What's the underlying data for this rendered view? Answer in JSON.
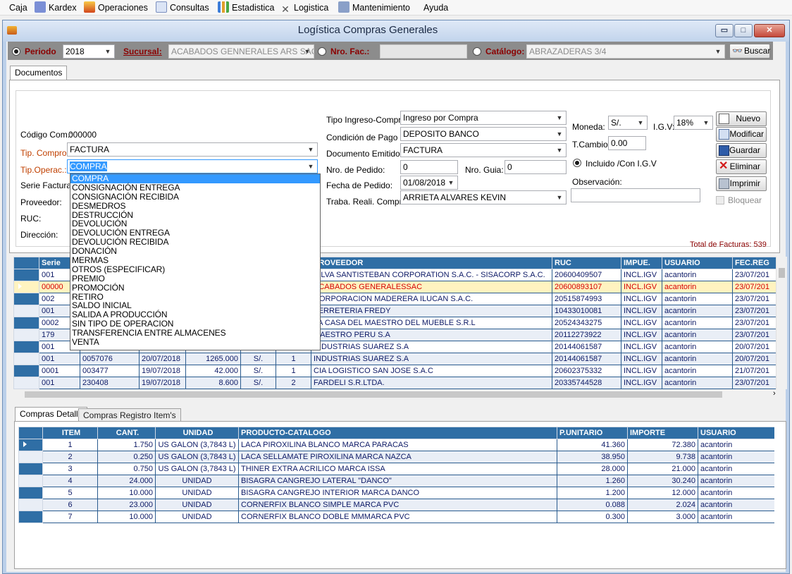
{
  "menu": [
    {
      "label": "Caja",
      "icon": "none"
    },
    {
      "label": "Kardex",
      "icon": "kardex-icon"
    },
    {
      "label": "Operaciones",
      "icon": "fire-icon"
    },
    {
      "label": "Consultas",
      "icon": "edit-icon"
    },
    {
      "label": "Estadistica",
      "icon": "chart-icon"
    },
    {
      "label": "Logistica",
      "icon": "tools-icon"
    },
    {
      "label": "Mantenimiento",
      "icon": "maintenance-icon"
    },
    {
      "label": "Ayuda",
      "icon": "none"
    }
  ],
  "window": {
    "title": "Logística Compras Generales",
    "min": "▭",
    "max": "□",
    "close": "✕"
  },
  "filter": {
    "periodo_label": "Periodo",
    "periodo_value": "2018",
    "sucursal_label": "Sucursal:",
    "sucursal_value": "ACABADOS GENNERALES ARS SAC",
    "nrofac_label": "Nro. Fac.:",
    "nrofac_value": "",
    "catalogo_label": "Catálogo:",
    "catalogo_value": "ABRAZADERAS 3/4",
    "buscar_label": "Buscar"
  },
  "tabs_top": {
    "documentos": "Documentos"
  },
  "form": {
    "codigo_label": "Código Com.:",
    "codigo_value": "000000",
    "tipcompro_label": "Tip. Compro.:",
    "tipcompro_value": "FACTURA",
    "tipoperac_label": "Tip.Operac.:",
    "tipoperac_value": "COMPRA",
    "serie_label": "Serie Factura:",
    "proveedor_label": "Proveedor:",
    "ruc_label": "RUC:",
    "direccion_label": "Dirección:",
    "tipo_ingreso_label": "Tipo Ingreso-Compra:",
    "tipo_ingreso_value": "Ingreso por Compra",
    "condicion_label": "Condición de Pago",
    "condicion_value": "DEPOSITO BANCO",
    "documento_label": "Documento Emitido:",
    "documento_value": "FACTURA",
    "nropedido_label": "Nro. de Pedido:",
    "nropedido_value": "0",
    "nroguia_label": "Nro. Guia:",
    "nroguia_value": "0",
    "fecha_label": "Fecha de Pedido:",
    "fecha_value": "01/08/2018",
    "trabajador_label": "Traba. Reali. Compra",
    "trabajador_value": "ARRIETA ALVARES KEVIN",
    "moneda_label": "Moneda:",
    "moneda_value": "S/.",
    "igv_label": "I.G.V:",
    "igv_value": "18%",
    "tcambio_label": "T.Cambio:",
    "tcambio_value": "0.00",
    "incluido_label": "Incluido /Con I.G.V",
    "observacion_label": "Observación:",
    "bloquear_label": "Bloquear",
    "total_label": "Total de Facturas:",
    "total_value": "539"
  },
  "actions": {
    "nuevo": "Nuevo",
    "modificar": "Modificar",
    "guardar": "Guardar",
    "eliminar": "Eliminar",
    "imprimir": "Imprimir"
  },
  "dropdown_items": [
    "COMPRA",
    "CONSIGNACIÓN ENTREGA",
    "CONSIGNACIÓN RECIBIDA",
    "DESMEDROS",
    "DESTRUCCIÓN",
    "DEVOLUCIÓN",
    "DEVOLUCIÓN ENTREGA",
    "DEVOLUCIÓN RECIBIDA",
    "DONACIÓN",
    "MERMAS",
    "OTROS (ESPECIFICAR)",
    "PREMIO",
    "PROMOCIÓN",
    "RETIRO",
    "SALDO INICIAL",
    "SALIDA A PRODUCCIÓN",
    "SIN TIPO DE OPERACION",
    "TRANSFERENCIA ENTRE ALMACENES",
    "VENTA"
  ],
  "grid1": {
    "headers": [
      "Serie",
      "",
      "",
      "",
      "",
      "",
      "PROVEEDOR",
      "RUC",
      "IMPUE.",
      "USUARIO",
      "FEC.REG"
    ],
    "rows": [
      {
        "serie": "001",
        "num": "",
        "fecha": "",
        "total": "",
        "mon": "",
        "cant": "",
        "prov": "SILVA SANTISTEBAN CORPORATION S.A.C. - SISACORP S.A.C.",
        "ruc": "20600409507",
        "imp": "INCL.IGV",
        "usr": "acantorin",
        "fec": "23/07/201"
      },
      {
        "serie": "00000",
        "num": "",
        "fecha": "",
        "total": "",
        "mon": "",
        "cant": "",
        "prov": "ACABADOS GENERALESSAC",
        "ruc": "20600893107",
        "imp": "INCL.IGV",
        "usr": "acantorin",
        "fec": "23/07/201"
      },
      {
        "serie": "002",
        "num": "",
        "fecha": "",
        "total": "",
        "mon": "",
        "cant": "",
        "prov": "CORPORACION MADERERA ILUCAN S.A.C.",
        "ruc": "20515874993",
        "imp": "INCL.IGV",
        "usr": "acantorin",
        "fec": "23/07/201"
      },
      {
        "serie": "001",
        "num": "",
        "fecha": "",
        "total": "",
        "mon": "",
        "cant": "",
        "prov": "FERRETERIA FREDY",
        "ruc": "10433010081",
        "imp": "INCL.IGV",
        "usr": "acantorin",
        "fec": "23/07/201"
      },
      {
        "serie": "0002",
        "num": "",
        "fecha": "",
        "total": "",
        "mon": "",
        "cant": "",
        "prov": "LA CASA DEL MAESTRO DEL MUEBLE S.R.L",
        "ruc": "20524343275",
        "imp": "INCL.IGV",
        "usr": "acantorin",
        "fec": "23/07/201"
      },
      {
        "serie": "179",
        "num": "",
        "fecha": "",
        "total": "",
        "mon": "",
        "cant": "",
        "prov": "MAESTRO PERU S.A",
        "ruc": "20112273922",
        "imp": "INCL.IGV",
        "usr": "acantorin",
        "fec": "23/07/201"
      },
      {
        "serie": "001",
        "num": "",
        "fecha": "",
        "total": "",
        "mon": "",
        "cant": "",
        "prov": "INDUSTRIAS SUAREZ S.A",
        "ruc": "20144061587",
        "imp": "INCL.IGV",
        "usr": "acantorin",
        "fec": "20/07/201"
      },
      {
        "serie": "001",
        "num": "0057076",
        "fecha": "20/07/2018",
        "total": "1265.000",
        "mon": "S/.",
        "cant": "1",
        "prov": "INDUSTRIAS SUAREZ S.A",
        "ruc": "20144061587",
        "imp": "INCL.IGV",
        "usr": "acantorin",
        "fec": "20/07/201"
      },
      {
        "serie": "0001",
        "num": "003477",
        "fecha": "19/07/2018",
        "total": "42.000",
        "mon": "S/.",
        "cant": "1",
        "prov": "CIA LOGISTICO SAN JOSE S.A.C",
        "ruc": "20602375332",
        "imp": "INCL.IGV",
        "usr": "acantorin",
        "fec": "21/07/201"
      },
      {
        "serie": "001",
        "num": "230408",
        "fecha": "19/07/2018",
        "total": "8.600",
        "mon": "S/.",
        "cant": "2",
        "prov": "FARDELI S.R.LTDA.",
        "ruc": "20335744528",
        "imp": "INCL.IGV",
        "usr": "acantorin",
        "fec": "23/07/201"
      }
    ]
  },
  "tabs_bottom": {
    "detalle": "Compras Detalle",
    "registro": "Compras Registro Item's"
  },
  "grid2": {
    "headers": [
      "ITEM",
      "CANT.",
      "UNIDAD",
      "PRODUCTO-CATALOGO",
      "P.UNITARIO",
      "IMPORTE",
      "USUARIO"
    ],
    "rows": [
      {
        "item": "1",
        "cant": "1.750",
        "unidad": "US GALON (3,7843 L)",
        "prod": "LACA PIROXILINA BLANCO MARCA PARACAS",
        "pu": "41.360",
        "imp": "72.380",
        "usr": "acantorin"
      },
      {
        "item": "2",
        "cant": "0.250",
        "unidad": "US GALON (3,7843 L)",
        "prod": "LACA SELLAMATE PIROXILINA MARCA NAZCA",
        "pu": "38.950",
        "imp": "9.738",
        "usr": "acantorin"
      },
      {
        "item": "3",
        "cant": "0.750",
        "unidad": "US GALON (3,7843 L)",
        "prod": "THINER EXTRA ACRILICO MARCA ISSA",
        "pu": "28.000",
        "imp": "21.000",
        "usr": "acantorin"
      },
      {
        "item": "4",
        "cant": "24.000",
        "unidad": "UNIDAD",
        "prod": "BISAGRA CANGREJO LATERAL \"DANCO\"",
        "pu": "1.260",
        "imp": "30.240",
        "usr": "acantorin"
      },
      {
        "item": "5",
        "cant": "10.000",
        "unidad": "UNIDAD",
        "prod": "BISAGRA CANGREJO INTERIOR MARCA DANCO",
        "pu": "1.200",
        "imp": "12.000",
        "usr": "acantorin"
      },
      {
        "item": "6",
        "cant": "23.000",
        "unidad": "UNIDAD",
        "prod": "CORNERFIX BLANCO SIMPLE MARCA PVC",
        "pu": "0.088",
        "imp": "2.024",
        "usr": "acantorin"
      },
      {
        "item": "7",
        "cant": "10.000",
        "unidad": "UNIDAD",
        "prod": "CORNERFIX BLANCO DOBLE MMMARCA PVC",
        "pu": "0.300",
        "imp": "3.000",
        "usr": "acantorin"
      }
    ]
  }
}
